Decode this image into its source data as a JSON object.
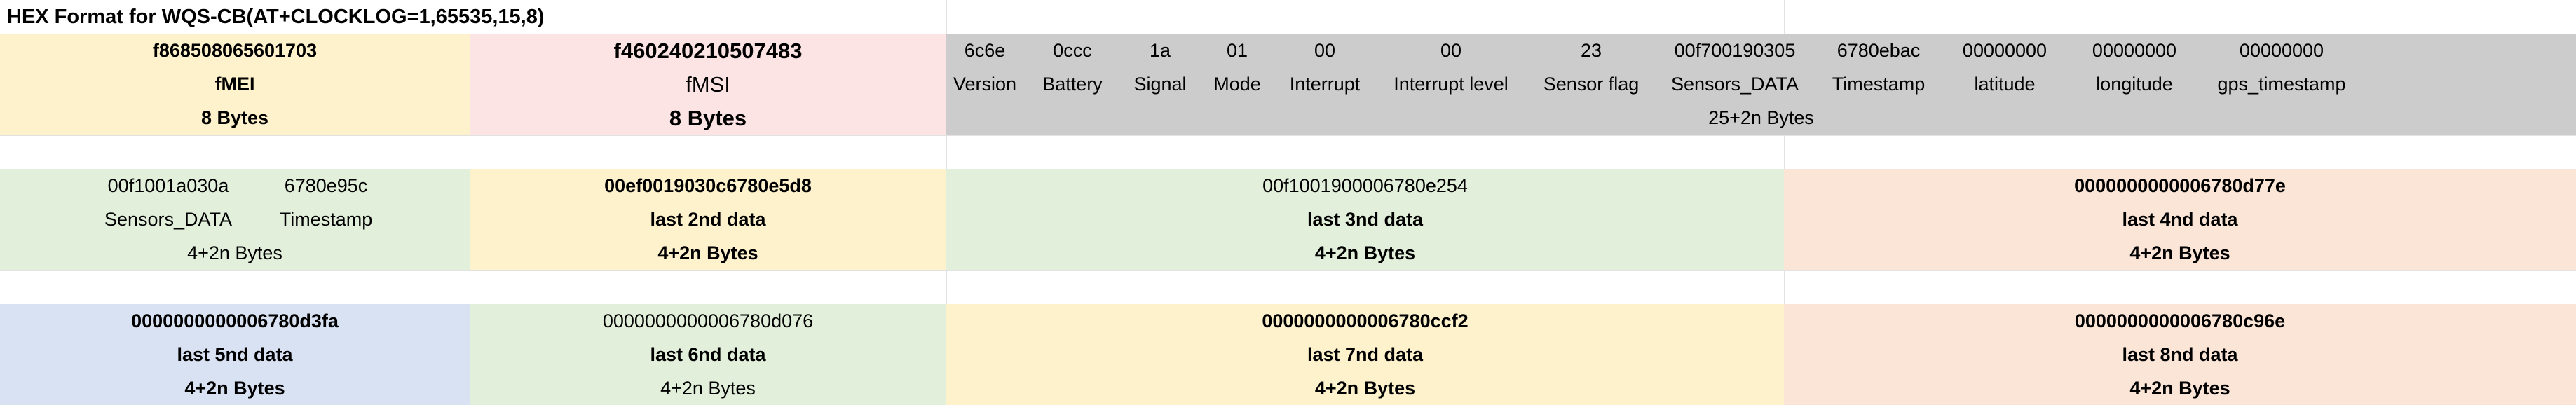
{
  "title": "HEX Format for WQS-CB(AT+CLOCKLOG=1,65535,15,8)",
  "colors": {
    "yellow": "#fef2cc",
    "pink": "#fde4e4",
    "gray": "#cccccc",
    "green": "#e2efda",
    "peach": "#fbe5d6",
    "blue": "#d9e2f3"
  },
  "header": {
    "imei": {
      "value": "f868508065601703",
      "name": "fMEI",
      "size": "8 Bytes"
    },
    "imsi": {
      "value": "f460240210507483",
      "name": "fMSI",
      "size": "8 Bytes"
    },
    "payload_size": "25+2n Bytes",
    "fields": [
      {
        "value": "6c6e",
        "label": "Version"
      },
      {
        "value": "0ccc",
        "label": "Battery"
      },
      {
        "value": "1a",
        "label": "Signal"
      },
      {
        "value": "01",
        "label": "Mode"
      },
      {
        "value": "00",
        "label": "Interrupt"
      },
      {
        "value": "00",
        "label": "Interrupt level"
      },
      {
        "value": "23",
        "label": "Sensor flag"
      },
      {
        "value": "00f700190305",
        "label": "Sensors_DATA"
      },
      {
        "value": "6780ebac",
        "label": "Timestamp"
      },
      {
        "value": "00000000",
        "label": "latitude"
      },
      {
        "value": "00000000",
        "label": "longitude"
      },
      {
        "value": "00000000",
        "label": "gps_timestamp"
      }
    ]
  },
  "log_row1": {
    "first": {
      "sensors_value": "00f1001a030a",
      "timestamp_value": "6780e95c",
      "sensors_label": "Sensors_DATA",
      "timestamp_label": "Timestamp",
      "size": "4+2n Bytes"
    },
    "b2": {
      "value": "00ef0019030c6780e5d8",
      "label": "last 2nd data",
      "size": "4+2n Bytes"
    },
    "b3": {
      "value": "00f1001900006780e254",
      "label": "last 3nd data",
      "size": "4+2n Bytes"
    },
    "b4": {
      "value": "0000000000006780d77e",
      "label": "last 4nd data",
      "size": "4+2n Bytes"
    }
  },
  "log_row2": {
    "b5": {
      "value": "0000000000006780d3fa",
      "label": "last 5nd data",
      "size": "4+2n Bytes"
    },
    "b6": {
      "value": "0000000000006780d076",
      "label": "last 6nd data",
      "size": "4+2n Bytes"
    },
    "b7": {
      "value": "0000000000006780ccf2",
      "label": "last 7nd data",
      "size": "4+2n Bytes"
    },
    "b8": {
      "value": "0000000000006780c96e",
      "label": "last 8nd data",
      "size": "4+2n Bytes"
    }
  }
}
